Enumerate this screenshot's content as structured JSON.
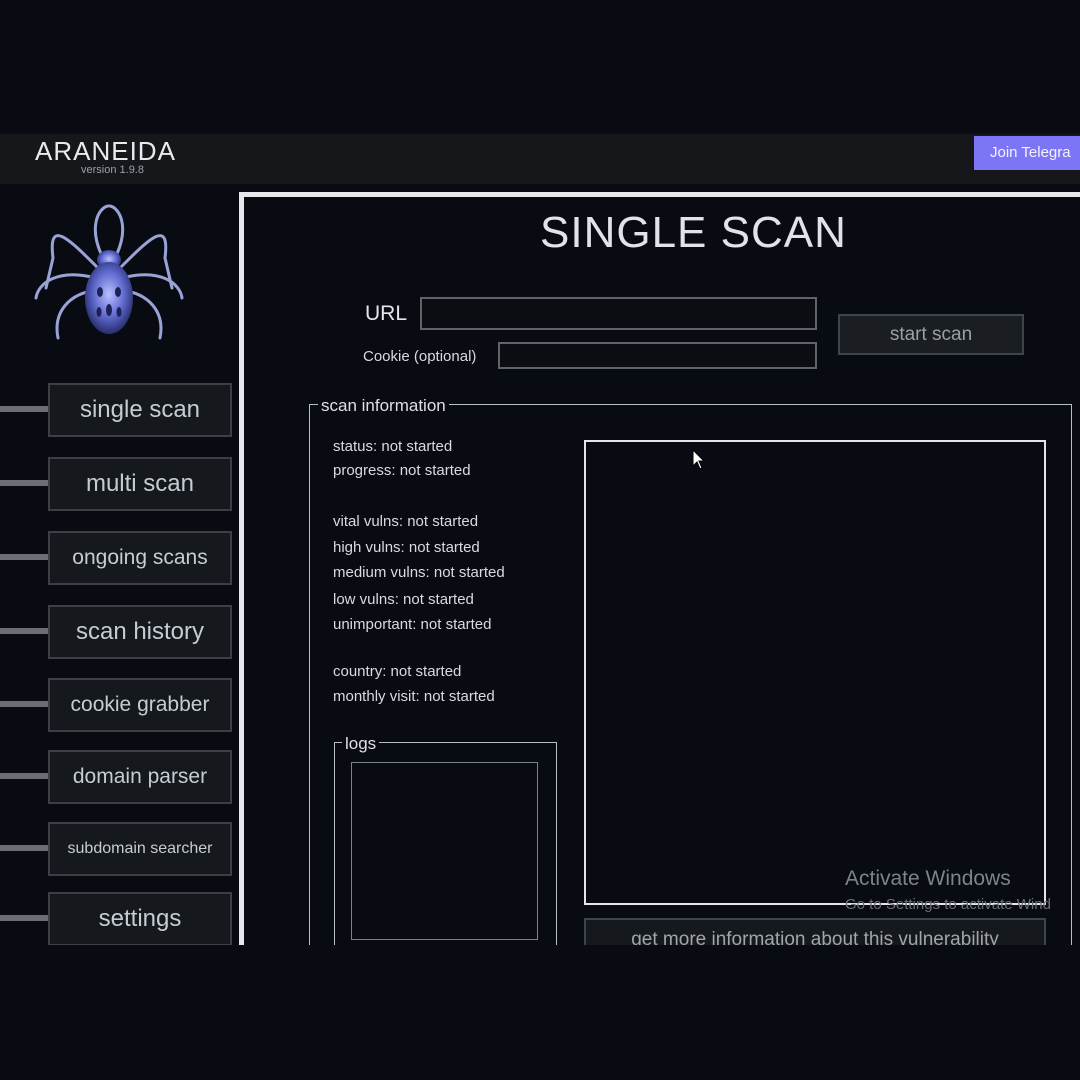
{
  "app": {
    "name": "ARANEIDA",
    "version": "version 1.9.8",
    "telegram_label": "Join Telegra"
  },
  "sidebar": {
    "logo_icon": "spider-icon",
    "items": [
      {
        "label": "single scan"
      },
      {
        "label": "multi scan"
      },
      {
        "label": "ongoing scans"
      },
      {
        "label": "scan history"
      },
      {
        "label": "cookie grabber"
      },
      {
        "label": "domain parser"
      },
      {
        "label": "subdomain searcher"
      },
      {
        "label": "settings"
      }
    ]
  },
  "main": {
    "title": "SINGLE SCAN",
    "url_label": "URL",
    "url_value": "",
    "cookie_label": "Cookie (optional)",
    "cookie_value": "",
    "start_button": "start scan",
    "scan_info": {
      "title": "scan information",
      "status": "status: not started",
      "progress": "progress: not started",
      "vital": "vital vulns: not started",
      "high": "high vulns: not started",
      "medium": "medium vulns: not started",
      "low": "low vulns: not started",
      "unimportant": "unimportant: not started",
      "country": "country: not started",
      "monthly": "monthly visit: not started"
    },
    "logs_title": "logs",
    "more_info_button": "get more information about this vulnerability"
  },
  "overlay": {
    "activate_title": "Activate Windows",
    "activate_sub": "Go to Settings to activate Wind"
  },
  "colors": {
    "background": "#090b12",
    "accent": "#7c75f5",
    "border": "#e6e8eb"
  }
}
